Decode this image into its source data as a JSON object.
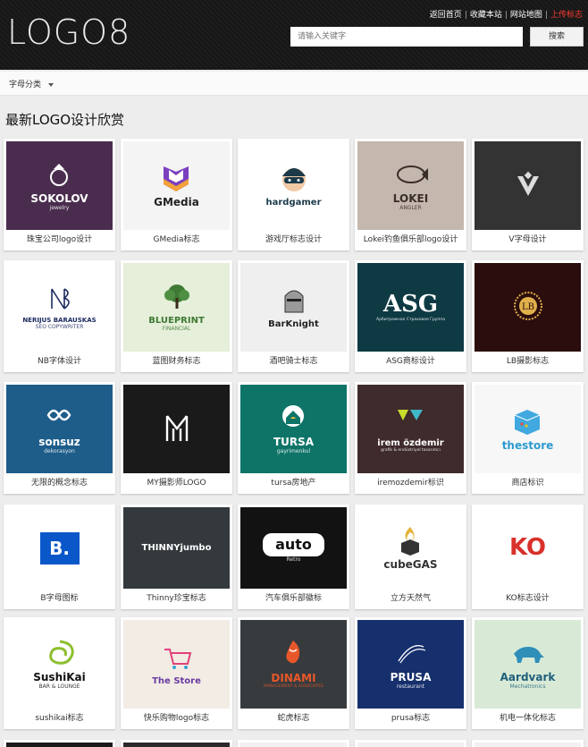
{
  "header": {
    "logo": "LOGO8",
    "links": [
      "返回首页",
      "收藏本站",
      "网站地图"
    ],
    "hot_link": "上传标志",
    "search_placeholder": "请输入关键字",
    "search_button": "搜索"
  },
  "filter": {
    "label": "字母分类"
  },
  "section_title": "最新LOGO设计欣赏",
  "cards": [
    {
      "caption": "珠宝公司logo设计",
      "bg": "#4a2d4e",
      "fg": "#ffffff",
      "text": "SOKOLOV",
      "sub": "jewelry",
      "icon": "ring-icon"
    },
    {
      "caption": "GMedia标志",
      "bg": "#f4f4f4",
      "fg": "#222222",
      "text": "GMedia",
      "sub": "",
      "icon": "gm-shield-icon"
    },
    {
      "caption": "游戏厅标志设计",
      "bg": "#ffffff",
      "fg": "#1b3b4a",
      "text": "hardgamer",
      "sub": "",
      "icon": "gamer-face-icon"
    },
    {
      "caption": "Lokei钓鱼俱乐部logo设计",
      "bg": "#c4b7ad",
      "fg": "#3a2e28",
      "text": "LOKEI",
      "sub": "ANGLER",
      "icon": "fish-icon"
    },
    {
      "caption": "V字母设计",
      "bg": "#333333",
      "fg": "#ffffff",
      "text": "",
      "sub": "",
      "icon": "v-diamond-icon"
    },
    {
      "caption": "NB字体设计",
      "bg": "#ffffff",
      "fg": "#1d2a60",
      "text": "NERIJUS BARAUSKAS",
      "sub": "SEO COPYWRITER",
      "icon": "nb-monogram-icon"
    },
    {
      "caption": "蓝图财务标志",
      "bg": "#e5efd9",
      "fg": "#3f7a34",
      "text": "BLUEPRINT",
      "sub": "FINANCIAL",
      "icon": "tree-icon"
    },
    {
      "caption": "酒吧骑士标志",
      "bg": "#efefef",
      "fg": "#222222",
      "text": "BarKnight",
      "sub": "",
      "icon": "knight-helmet-icon"
    },
    {
      "caption": "ASG商标设计",
      "bg": "#0e3a43",
      "fg": "#ffffff",
      "text": "ASG",
      "sub": "Арбитражная Страховая Группа",
      "icon": "asg-letters-icon"
    },
    {
      "caption": "LB摄影标志",
      "bg": "#2b0d0d",
      "fg": "#e0b04a",
      "text": "",
      "sub": "",
      "icon": "lb-seal-icon"
    },
    {
      "caption": "无限的概念标志",
      "bg": "#1e5d8a",
      "fg": "#ffffff",
      "text": "sonsuz",
      "sub": "dekorasyon",
      "icon": "infinity-icon"
    },
    {
      "caption": "MY摄影师LOGO",
      "bg": "#1a1a1a",
      "fg": "#ffffff",
      "text": "",
      "sub": "",
      "icon": "my-monogram-icon"
    },
    {
      "caption": "tursa房地产",
      "bg": "#0e7468",
      "fg": "#ffffff",
      "text": "TURSA",
      "sub": "gayrimenkul",
      "icon": "house-icon"
    },
    {
      "caption": "iremozdemir标识",
      "bg": "#3f2b2c",
      "fg": "#ffffff",
      "text": "irem özdemir",
      "sub": "grafik & endüstriyel tasarımcı",
      "icon": "triangles-icon"
    },
    {
      "caption": "商店标识",
      "bg": "#f7f7f7",
      "fg": "#2e9ad0",
      "text": "thestore",
      "sub": "",
      "icon": "cube-icon"
    },
    {
      "caption": "B字母图标",
      "bg": "#ffffff",
      "fg": "#ffffff",
      "text": "B.",
      "sub": "",
      "icon": "b-square-icon"
    },
    {
      "caption": "Thinny珍宝标志",
      "bg": "#33393d",
      "fg": "#ffffff",
      "text": "THINNYjumbo",
      "sub": "",
      "icon": "jumbo-icon"
    },
    {
      "caption": "汽车俱乐部徽标",
      "bg": "#121212",
      "fg": "#ffffff",
      "text": "auto",
      "sub": "Retro",
      "icon": "auto-badge-icon"
    },
    {
      "caption": "立方天然气",
      "bg": "#ffffff",
      "fg": "#333333",
      "text": "cubeGAS",
      "sub": "",
      "icon": "flame-cube-icon"
    },
    {
      "caption": "KO标志设计",
      "bg": "#ffffff",
      "fg": "#d9302b",
      "text": "KO",
      "sub": "",
      "icon": "ko-letters-icon"
    },
    {
      "caption": "sushikai标志",
      "bg": "#ffffff",
      "fg": "#111111",
      "text": "SushiKai",
      "sub": "BAR & LOUNGE",
      "icon": "swirl-icon"
    },
    {
      "caption": "快乐购物logo标志",
      "bg": "#f2ece4",
      "fg": "#6a3aa0",
      "text": "The Store",
      "sub": "",
      "icon": "cart-icon"
    },
    {
      "caption": "蛇虎标志",
      "bg": "#373b3e",
      "fg": "#e8572a",
      "text": "DINAMI",
      "sub": "MANAGEMENT & ASSOCIATES",
      "icon": "tiger-icon"
    },
    {
      "caption": "prusa标志",
      "bg": "#16306d",
      "fg": "#ffffff",
      "text": "PRUSA",
      "sub": "restaurant",
      "icon": "wave-icon"
    },
    {
      "caption": "机电一体化标志",
      "bg": "#d8ead6",
      "fg": "#1f5f7a",
      "text": "Aardvark",
      "sub": "Mechatronics",
      "icon": "aardvark-icon"
    }
  ],
  "peek_row_colors": [
    "#1a1a1a",
    "#2a2a2a",
    "#f1f1f1",
    "#f1f1f1",
    "#f1f1f1"
  ]
}
